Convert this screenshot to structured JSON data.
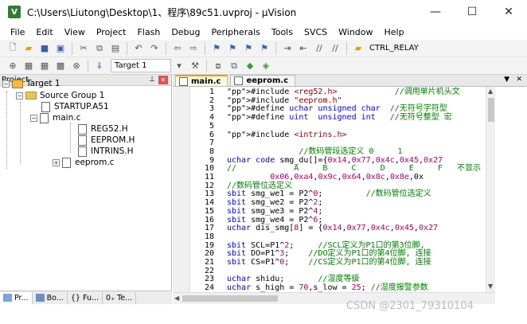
{
  "window": {
    "title": "C:\\Users\\Liutong\\Desktop\\1、程序\\89c51.uvproj - µVision",
    "app_icon_label": "V",
    "controls": [
      "—",
      "☐",
      "✕"
    ]
  },
  "menu": [
    "File",
    "Edit",
    "View",
    "Project",
    "Flash",
    "Debug",
    "Peripherals",
    "Tools",
    "SVCS",
    "Window",
    "Help"
  ],
  "toolbar": {
    "target_label": "CTRL_RELAY",
    "target_select": "Target 1"
  },
  "project_pane": {
    "title": "Project",
    "tree": {
      "target": "Target 1",
      "group": "Source Group 1",
      "files": [
        "STARTUP.A51",
        "main.c",
        "REG52.H",
        "EEPROM.H",
        "INTRINS.H",
        "eeprom.c"
      ]
    },
    "tabs": [
      "Pr...",
      "Bo...",
      "{} Fu...",
      "0₊ Te..."
    ]
  },
  "editor": {
    "tabs": [
      "main.c",
      "eeprom.c"
    ],
    "lines": [
      {
        "n": "1",
        "t": "#include <reg52.h>            //调用单片机头文"
      },
      {
        "n": "2",
        "t": "#include \"eeprom.h\""
      },
      {
        "n": "3",
        "t": "#define uchar unsigned char  //无符号字符型"
      },
      {
        "n": "4",
        "t": "#define uint  unsigned int   //无符号整型 宏"
      },
      {
        "n": "5",
        "t": ""
      },
      {
        "n": "6",
        "t": "#include <intrins.h>"
      },
      {
        "n": "7",
        "t": ""
      },
      {
        "n": "8",
        "t": "               //数码管段选定义 0     1"
      },
      {
        "n": "9",
        "t": "uchar code smg_du[]={0x14,0x77,0x4c,0x45,0x27"
      },
      {
        "n": "10",
        "t": "//            A     B     C     D     E     F   不显示"
      },
      {
        "n": "11",
        "t": "         0x06,0xa4,0x9c,0x64,0x8c,0x8e,0x"
      },
      {
        "n": "12",
        "t": "//数码管位选定义"
      },
      {
        "n": "13",
        "t": "sbit smg_we1 = P2^0;         //数码管位选定义"
      },
      {
        "n": "14",
        "t": "sbit smg_we2 = P2^2;"
      },
      {
        "n": "15",
        "t": "sbit smg_we3 = P2^4;"
      },
      {
        "n": "16",
        "t": "sbit smg_we4 = P2^6;"
      },
      {
        "n": "17",
        "t": "uchar dis_smg[8] = {0x14,0x77,0x4c,0x45,0x27"
      },
      {
        "n": "18",
        "t": ""
      },
      {
        "n": "19",
        "t": "sbit SCL=P1^2;     //SCL定义为P1口的第3位脚,"
      },
      {
        "n": "20",
        "t": "sbit DO=P1^3;    //DO定义为P1口的第4位脚, 连接"
      },
      {
        "n": "21",
        "t": "sbit CS=P1^0;    //CS定义为P1口的第4位脚, 连接"
      },
      {
        "n": "22",
        "t": ""
      },
      {
        "n": "23",
        "t": "uchar shidu;       //湿度等级"
      },
      {
        "n": "24",
        "t": "uchar s_high = 70,s_low = 25; //湿度报警参数"
      }
    ]
  },
  "watermark": "CSDN @2301_79310104",
  "colors": {
    "keyword": "#0000ff",
    "comment": "#008000",
    "string": "#8b0000",
    "preprocessor": "#7f00ff"
  }
}
